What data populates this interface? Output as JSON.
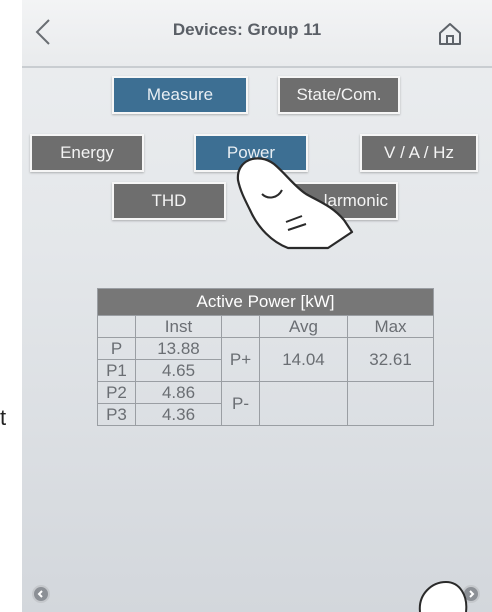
{
  "header": {
    "title": "Devices: Group 11",
    "back_icon": "chevron-left-icon",
    "home_icon": "home-icon"
  },
  "view_tabs": {
    "measure": "Measure",
    "state": "State/Com."
  },
  "measure_tabs": {
    "energy": "Energy",
    "power": "Power",
    "vahz": "V / A / Hz",
    "thd": "THD",
    "harmonic": "larmonic"
  },
  "table": {
    "caption": "Active Power [kW]",
    "col_inst": "Inst",
    "col_avg": "Avg",
    "col_max": "Max",
    "rows": [
      {
        "label": "P",
        "inst": "13.88"
      },
      {
        "label": "P1",
        "inst": "4.65"
      },
      {
        "label": "P2",
        "inst": "4.86"
      },
      {
        "label": "P3",
        "inst": "4.36"
      }
    ],
    "p_plus": {
      "label": "P+",
      "avg": "14.04",
      "max": "32.61"
    },
    "p_minus": {
      "label": "P-",
      "avg": "",
      "max": ""
    }
  },
  "stray_letter": "t",
  "colors": {
    "active_tab": "#3d6f93",
    "inactive_tab": "#6e6e6e"
  }
}
